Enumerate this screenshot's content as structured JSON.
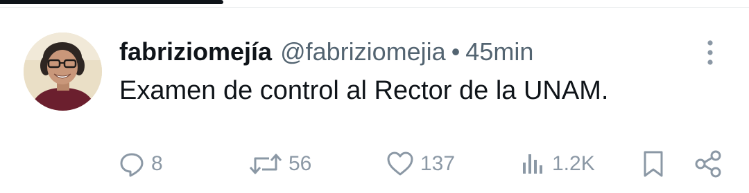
{
  "tweet": {
    "author": {
      "display_name": "fabriziomejía",
      "handle": "@fabriziomejia"
    },
    "separator": "•",
    "time": "45min",
    "text": "Examen de control al Rector de la UNAM.",
    "actions": {
      "reply": {
        "icon": "reply-icon",
        "count": "8"
      },
      "retweet": {
        "icon": "retweet-icon",
        "count": "56"
      },
      "like": {
        "icon": "heart-icon",
        "count": "137"
      },
      "views": {
        "icon": "views-icon",
        "count": "1.2K"
      },
      "bookmark": {
        "icon": "bookmark-icon"
      },
      "share": {
        "icon": "share-icon"
      }
    },
    "more_icon": "more-vertical-icon"
  },
  "colors": {
    "text_primary": "#0f1419",
    "text_secondary": "#536471",
    "action_gray": "#8b98a5",
    "divider": "#e6e9eb"
  }
}
